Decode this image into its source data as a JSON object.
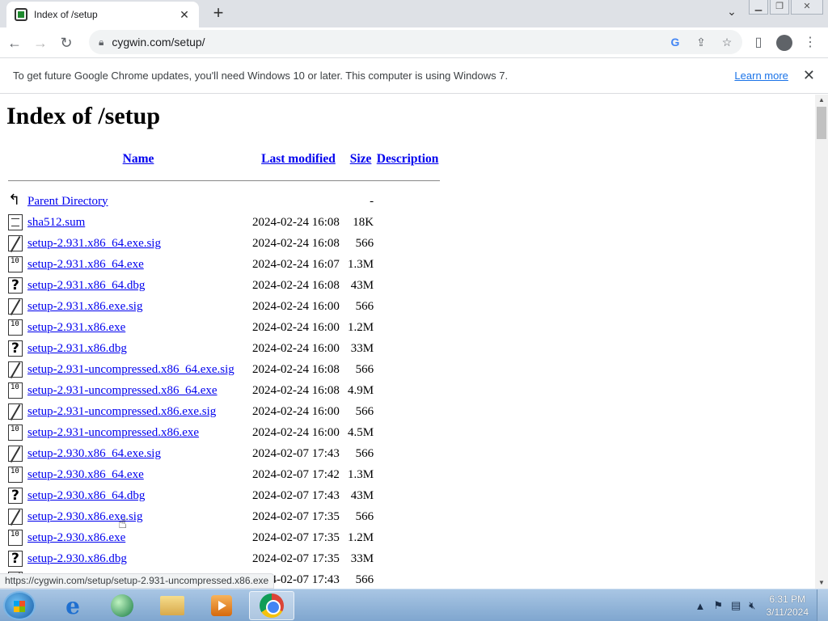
{
  "browser": {
    "tab": {
      "title": "Index of /setup",
      "close_icon": "close-icon"
    },
    "new_tab_label": "+",
    "omnibox": {
      "url": "cygwin.com/setup/"
    },
    "infobar": {
      "message": "To get future Google Chrome updates, you'll need Windows 10 or later. This computer is using Windows 7.",
      "learn_more": "Learn more"
    },
    "status_url": "https://cygwin.com/setup/setup-2.931-uncompressed.x86.exe"
  },
  "page": {
    "heading": "Index of /setup",
    "columns": {
      "name": "Name",
      "last_modified": "Last modified",
      "size": "Size",
      "description": "Description"
    },
    "parent": {
      "name": "Parent Directory",
      "size": "-",
      "icon": "back-icon"
    },
    "rows": [
      {
        "icon": "text",
        "name": "sha512.sum",
        "date": "2024-02-24 16:08",
        "size": "18K"
      },
      {
        "icon": "sig",
        "name": "setup-2.931.x86_64.exe.sig",
        "date": "2024-02-24 16:08",
        "size": "566"
      },
      {
        "icon": "bin",
        "name": "setup-2.931.x86_64.exe",
        "date": "2024-02-24 16:07",
        "size": "1.3M"
      },
      {
        "icon": "unk",
        "name": "setup-2.931.x86_64.dbg",
        "date": "2024-02-24 16:08",
        "size": "43M"
      },
      {
        "icon": "sig",
        "name": "setup-2.931.x86.exe.sig",
        "date": "2024-02-24 16:00",
        "size": "566"
      },
      {
        "icon": "bin",
        "name": "setup-2.931.x86.exe",
        "date": "2024-02-24 16:00",
        "size": "1.2M"
      },
      {
        "icon": "unk",
        "name": "setup-2.931.x86.dbg",
        "date": "2024-02-24 16:00",
        "size": "33M"
      },
      {
        "icon": "sig",
        "name": "setup-2.931-uncompressed.x86_64.exe.sig",
        "date": "2024-02-24 16:08",
        "size": "566"
      },
      {
        "icon": "bin",
        "name": "setup-2.931-uncompressed.x86_64.exe",
        "date": "2024-02-24 16:08",
        "size": "4.9M"
      },
      {
        "icon": "sig",
        "name": "setup-2.931-uncompressed.x86.exe.sig",
        "date": "2024-02-24 16:00",
        "size": "566"
      },
      {
        "icon": "bin",
        "name": "setup-2.931-uncompressed.x86.exe",
        "date": "2024-02-24 16:00",
        "size": "4.5M"
      },
      {
        "icon": "sig",
        "name": "setup-2.930.x86_64.exe.sig",
        "date": "2024-02-07 17:43",
        "size": "566"
      },
      {
        "icon": "bin",
        "name": "setup-2.930.x86_64.exe",
        "date": "2024-02-07 17:42",
        "size": "1.3M"
      },
      {
        "icon": "unk",
        "name": "setup-2.930.x86_64.dbg",
        "date": "2024-02-07 17:43",
        "size": "43M"
      },
      {
        "icon": "sig",
        "name": "setup-2.930.x86.exe.sig",
        "date": "2024-02-07 17:35",
        "size": "566"
      },
      {
        "icon": "bin",
        "name": "setup-2.930.x86.exe",
        "date": "2024-02-07 17:35",
        "size": "1.2M"
      },
      {
        "icon": "unk",
        "name": "setup-2.930.x86.dbg",
        "date": "2024-02-07 17:35",
        "size": "33M"
      },
      {
        "icon": "sig",
        "name": "",
        "date": "2024-02-07 17:43",
        "size": "566"
      }
    ]
  },
  "taskbar": {
    "clock_time": "6:31 PM",
    "clock_date": "3/11/2024",
    "apps": [
      "internet-explorer",
      "orb-app",
      "file-explorer",
      "media-player",
      "google-chrome"
    ]
  },
  "colors": {
    "link": "#0000ee",
    "taskbar": "#7fa6cf",
    "tabstrip": "#dee1e6"
  }
}
